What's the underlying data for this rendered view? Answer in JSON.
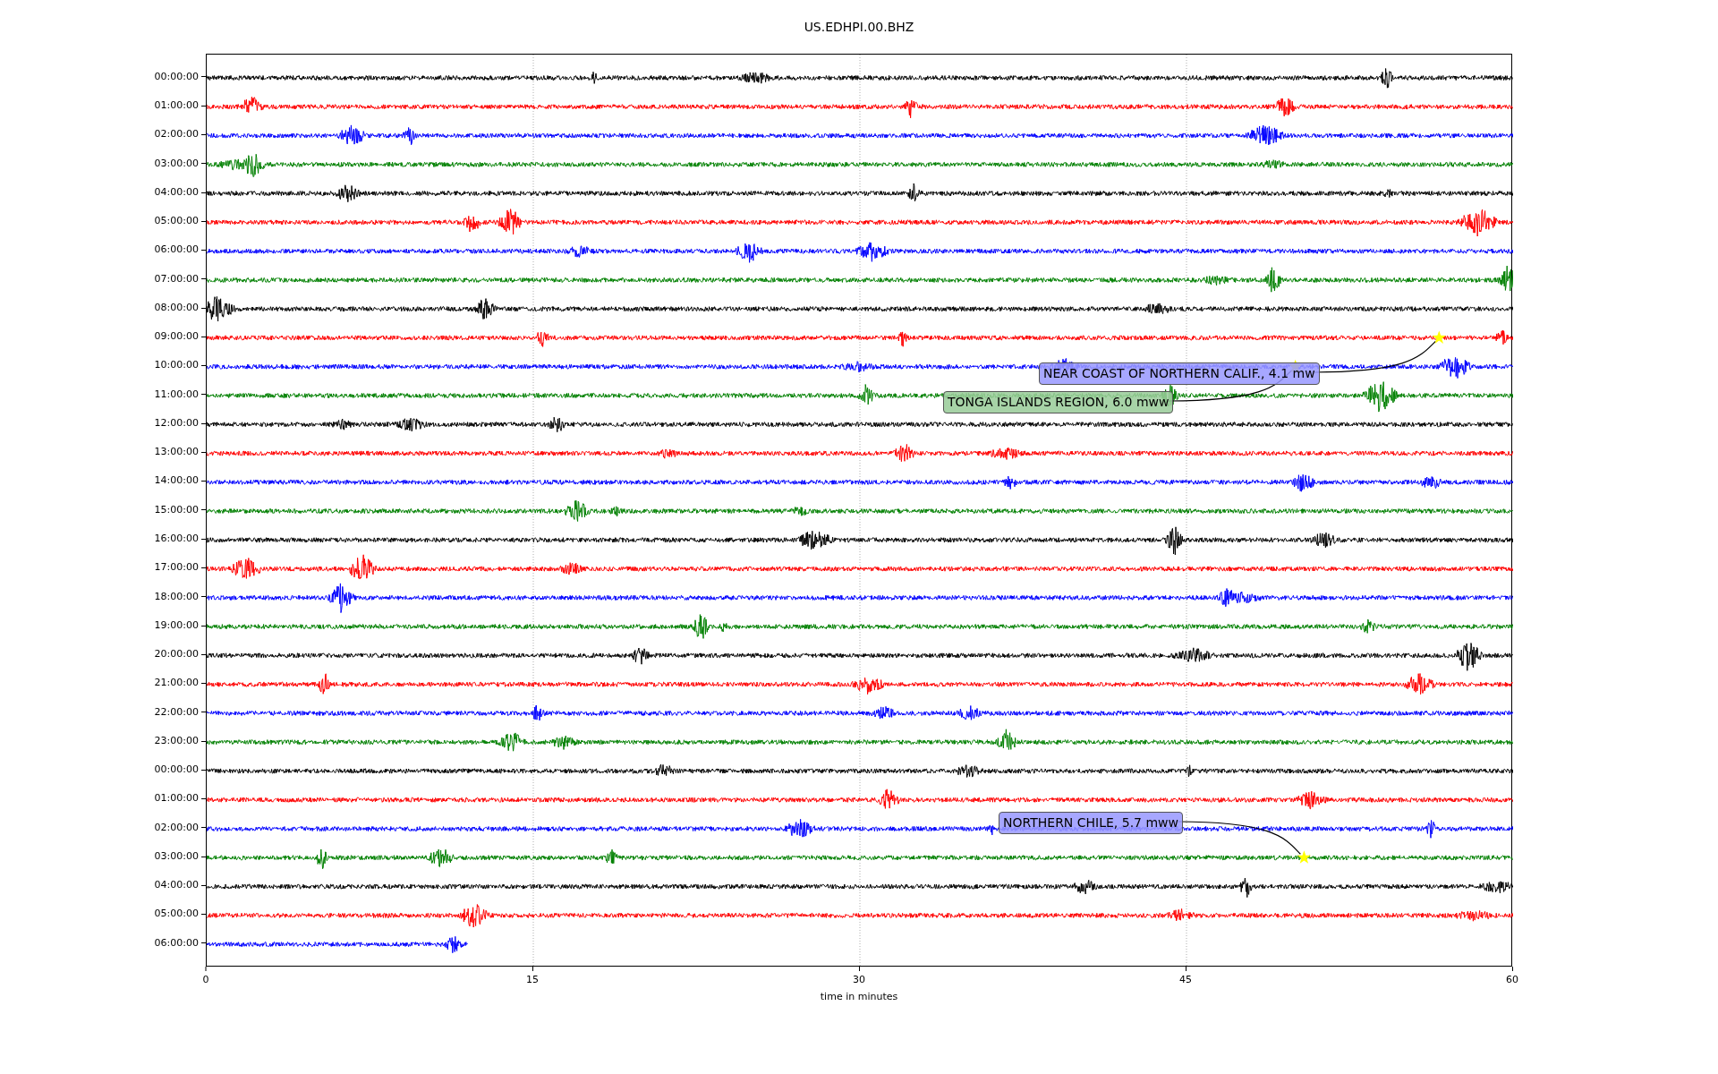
{
  "title": "US.EDHPI.00.BHZ",
  "rows": [
    {
      "label": "00:00:00",
      "color": "#000000",
      "level": 1
    },
    {
      "label": "01:00:00",
      "color": "#ff0000",
      "level": 1
    },
    {
      "label": "02:00:00",
      "color": "#0000ff",
      "level": 1
    },
    {
      "label": "03:00:00",
      "color": "#008000",
      "level": 1
    },
    {
      "label": "04:00:00",
      "color": "#000000",
      "level": 1
    },
    {
      "label": "05:00:00",
      "color": "#ff0000",
      "level": 1
    },
    {
      "label": "06:00:00",
      "color": "#0000ff",
      "level": 1
    },
    {
      "label": "07:00:00",
      "color": "#008000",
      "level": 1
    },
    {
      "label": "08:00:00",
      "color": "#000000",
      "level": 1
    },
    {
      "label": "09:00:00",
      "color": "#ff0000",
      "level": 1
    },
    {
      "label": "10:00:00",
      "color": "#0000ff",
      "level": 1
    },
    {
      "label": "11:00:00",
      "color": "#008000",
      "level": 1
    },
    {
      "label": "12:00:00",
      "color": "#000000",
      "level": 1
    },
    {
      "label": "13:00:00",
      "color": "#ff0000",
      "level": 1
    },
    {
      "label": "14:00:00",
      "color": "#0000ff",
      "level": 1
    },
    {
      "label": "15:00:00",
      "color": "#008000",
      "level": 1
    },
    {
      "label": "16:00:00",
      "color": "#000000",
      "level": 1
    },
    {
      "label": "17:00:00",
      "color": "#ff0000",
      "level": 1
    },
    {
      "label": "18:00:00",
      "color": "#0000ff",
      "level": 1
    },
    {
      "label": "19:00:00",
      "color": "#008000",
      "level": 1
    },
    {
      "label": "20:00:00",
      "color": "#000000",
      "level": 1
    },
    {
      "label": "21:00:00",
      "color": "#ff0000",
      "level": 1
    },
    {
      "label": "22:00:00",
      "color": "#0000ff",
      "level": 1
    },
    {
      "label": "23:00:00",
      "color": "#008000",
      "level": 1
    },
    {
      "label": "00:00:00",
      "color": "#000000",
      "level": 1
    },
    {
      "label": "01:00:00",
      "color": "#ff0000",
      "level": 1
    },
    {
      "label": "02:00:00",
      "color": "#0000ff",
      "level": 1
    },
    {
      "label": "03:00:00",
      "color": "#008000",
      "level": 1
    },
    {
      "label": "04:00:00",
      "color": "#000000",
      "level": 1
    },
    {
      "label": "05:00:00",
      "color": "#ff0000",
      "level": 1
    },
    {
      "label": "06:00:00",
      "color": "#0000ff",
      "level": 0.2
    }
  ],
  "xticks": [
    "0",
    "15",
    "30",
    "45",
    "60"
  ],
  "xlabel": "time in minutes",
  "events": [
    {
      "text": "NEAR COAST OF NORTHERN CALIF., 4.1 mw",
      "color": "#9999ff"
    },
    {
      "text": "TONGA ISLANDS REGION, 6.0 mww",
      "color": "#99cc99"
    },
    {
      "text": "NORTHERN CHILE, 5.7 mww",
      "color": "#9999ff"
    }
  ]
}
